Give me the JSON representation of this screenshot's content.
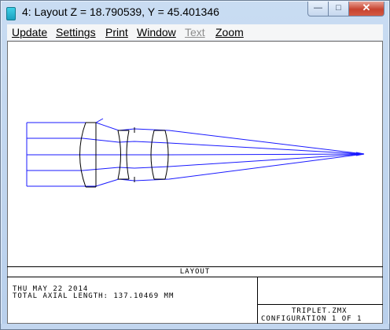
{
  "window": {
    "title": "4: Layout Z = 18.790539, Y = 45.401346",
    "controls": {
      "minimize": "—",
      "maximize": "□",
      "close": "✕"
    }
  },
  "menu": [
    {
      "label": "Update",
      "enabled": true
    },
    {
      "label": "Settings",
      "enabled": true
    },
    {
      "label": "Print",
      "enabled": true
    },
    {
      "label": "Window",
      "enabled": true
    },
    {
      "label": "Text",
      "enabled": false
    },
    {
      "label": "Zoom",
      "enabled": true
    }
  ],
  "plot": {
    "heading": "LAYOUT",
    "date_line": "THU MAY 22 2014",
    "length_line": "TOTAL AXIAL LENGTH:  137.10469 MM",
    "file_name": "TRIPLET.ZMX",
    "configuration": "CONFIGURATION 1 OF 1"
  },
  "colors": {
    "ray": "#1a1aff",
    "lens": "#000000",
    "close_button": "#c7432f"
  },
  "icons": [
    "app-icon",
    "minimize-icon",
    "maximize-icon",
    "close-icon"
  ]
}
